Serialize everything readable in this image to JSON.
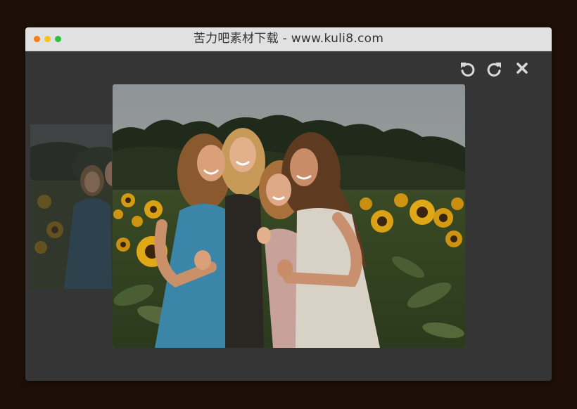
{
  "window": {
    "title": "苦力吧素材下载 - www.kuli8.com",
    "traffic_lights": [
      "close",
      "minimize",
      "maximize"
    ]
  },
  "toolbar": {
    "buttons": [
      {
        "name": "rotate-left",
        "icon": "rotate-left-icon"
      },
      {
        "name": "rotate-right",
        "icon": "rotate-right-icon"
      },
      {
        "name": "close",
        "icon": "close-icon"
      }
    ]
  },
  "viewer": {
    "current_image": "photo of four women smiling in a sunflower field",
    "previous_image": "dimmed preview of previous photo"
  },
  "colors": {
    "page_background": "#1e1006",
    "viewer_background": "#353535",
    "titlebar": "#e1e1e1",
    "icon": "#d9d9d9"
  }
}
